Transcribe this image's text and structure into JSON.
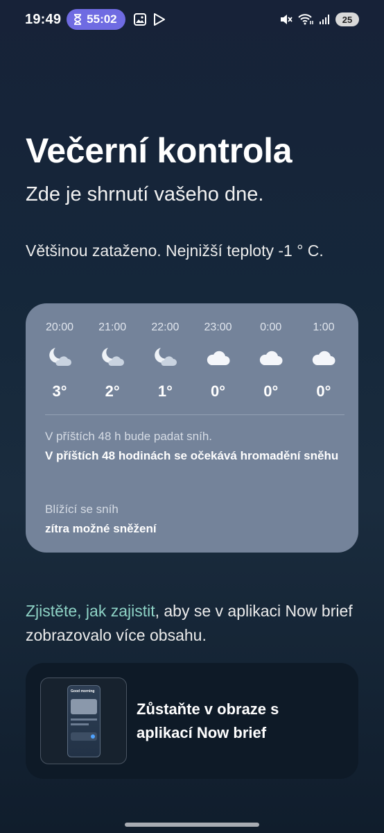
{
  "status_bar": {
    "time": "19:49",
    "timer": "55:02",
    "battery": "25"
  },
  "title": "Večerní kontrola",
  "subtitle": "Zde je shrnutí vašeho dne.",
  "summary": "Většinou zataženo. Nejnižší teploty -1 ° C.",
  "forecast": [
    {
      "time": "20:00",
      "icon": "moon-cloud-icon",
      "temp": "3°"
    },
    {
      "time": "21:00",
      "icon": "moon-cloud-icon",
      "temp": "2°"
    },
    {
      "time": "22:00",
      "icon": "moon-cloud-icon",
      "temp": "1°"
    },
    {
      "time": "23:00",
      "icon": "cloud-icon",
      "temp": "0°"
    },
    {
      "time": "0:00",
      "icon": "cloud-icon",
      "temp": "0°"
    },
    {
      "time": "1:00",
      "icon": "cloud-icon",
      "temp": "0°"
    }
  ],
  "alerts": [
    {
      "label": "V příštích 48 h bude padat sníh.",
      "text": "V příštích 48 hodinách se očekává hromadění sněhu"
    },
    {
      "label": "Blížící se sníh",
      "text": "zítra možné sněžení"
    }
  ],
  "promo": {
    "link": "Zjistěte, jak zajistit",
    "rest": ", aby se v aplikaci Now brief zobrazovalo více obsahu."
  },
  "card": {
    "title": "Zůstaňte v obraze s aplikací Now brief",
    "thumb_heading": "Good morning"
  },
  "colors": {
    "accent_link": "#8ed3c6",
    "timer_pill": "#6f6be2",
    "weather_card": "#74839a"
  }
}
